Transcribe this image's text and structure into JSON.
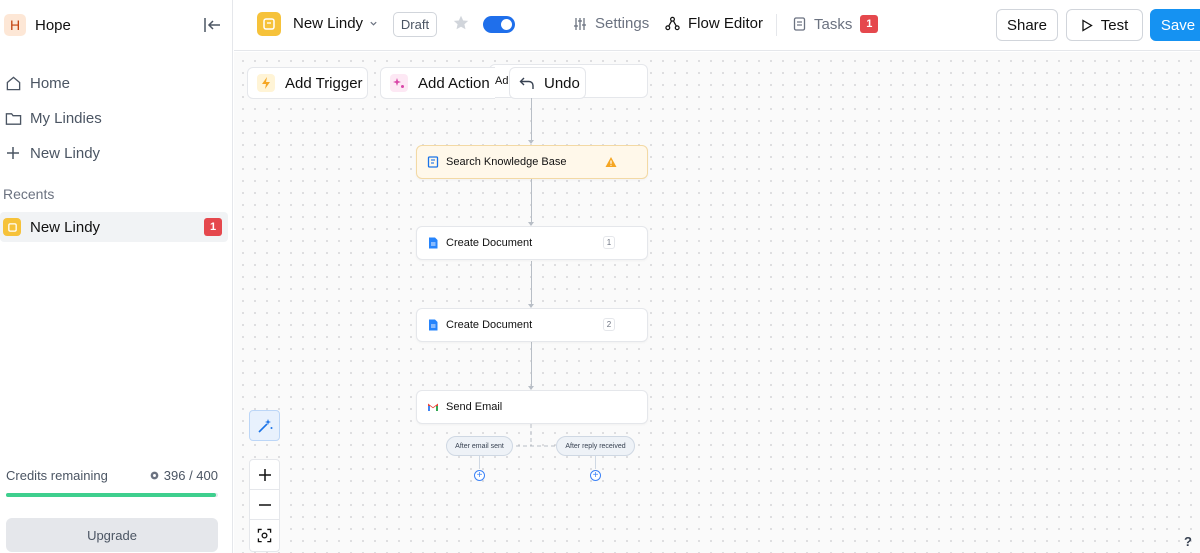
{
  "sidebar": {
    "workspace": {
      "initial": "H",
      "name": "Hope"
    },
    "nav": [
      {
        "label": "Home",
        "icon": "home-icon"
      },
      {
        "label": "My Lindies",
        "icon": "folder-icon"
      },
      {
        "label": "New Lindy",
        "icon": "plus-icon"
      }
    ],
    "recents_label": "Recents",
    "recents": [
      {
        "label": "New Lindy",
        "badge": "1"
      }
    ],
    "credits": {
      "label": "Credits remaining",
      "value": "396 / 400",
      "fraction": 0.99
    },
    "upgrade_label": "Upgrade"
  },
  "topbar": {
    "lindy_name": "New Lindy",
    "status": "Draft",
    "toggle_on": true,
    "settings_label": "Settings",
    "flow_editor_label": "Flow Editor",
    "tasks_label": "Tasks",
    "tasks_badge": "1",
    "share_label": "Share",
    "test_label": "Test",
    "save_label": "Save"
  },
  "canvas": {
    "add_trigger_label": "Add Trigger",
    "add_action_label": "Add Action",
    "hidden_fragment": "Ad",
    "undo_label": "Undo",
    "nodes": [
      {
        "label": "Search Knowledge Base",
        "icon": "knowledge-base-icon",
        "warning": true
      },
      {
        "label": "Create Document",
        "icon": "google-docs-icon",
        "number": "1"
      },
      {
        "label": "Create Document",
        "icon": "google-docs-icon",
        "number": "2"
      },
      {
        "label": "Send Email",
        "icon": "gmail-icon"
      }
    ],
    "branches": [
      "After email sent",
      "After reply received"
    ],
    "help_label": "?"
  },
  "colors": {
    "accent": "#1592f2",
    "toggle": "#1f6feb",
    "badge": "#e5484d",
    "progress": "#3ecf8e",
    "lindy_icon": "#f6c23a"
  }
}
